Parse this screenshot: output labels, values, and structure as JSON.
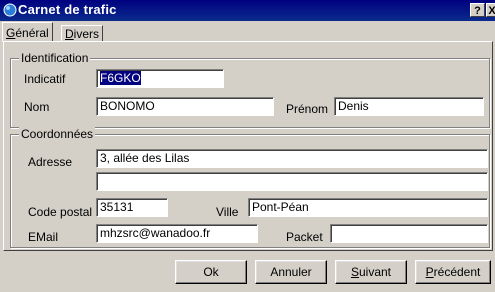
{
  "window": {
    "title": "Carnet de trafic",
    "help_label": "?",
    "close_label": "X"
  },
  "tabs": [
    {
      "label": "Général",
      "underline": "G",
      "rest": "énéral"
    },
    {
      "label": "Divers",
      "underline": "D",
      "rest": "ivers"
    }
  ],
  "identification": {
    "legend": "Identification",
    "indicatif_label": "Indicatif",
    "indicatif_value": "F6GKO",
    "nom_label": "Nom",
    "nom_value": "BONOMO",
    "prenom_label": "Prénom",
    "prenom_value": "Denis"
  },
  "coordonnees": {
    "legend": "Coordonnées",
    "adresse_label": "Adresse",
    "adresse_line1": "3, allée des Lilas",
    "adresse_line2": "",
    "code_postal_label": "Code postal",
    "code_postal_value": "35131",
    "ville_label": "Ville",
    "ville_value": "Pont-Péan",
    "email_label": "EMail",
    "email_value": "mhzsrc@wanadoo.fr",
    "packet_label": "Packet",
    "packet_value": ""
  },
  "buttons": {
    "ok": "Ok",
    "annuler": "Annuler",
    "suivant_u": "S",
    "suivant_rest": "uivant",
    "precedent_u": "P",
    "precedent_rest": "récédent"
  }
}
